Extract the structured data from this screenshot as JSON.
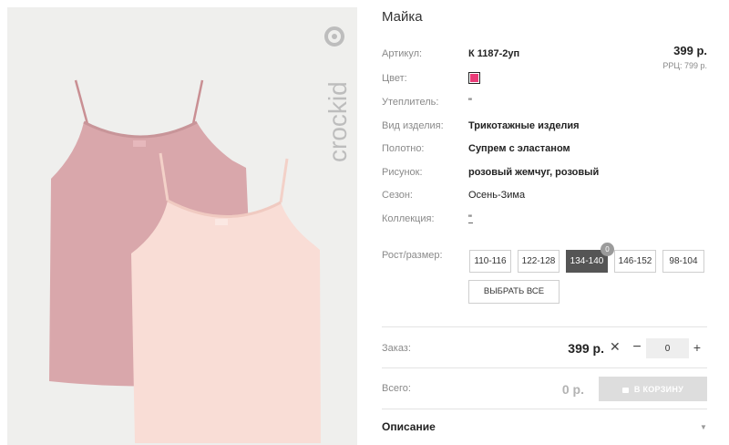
{
  "product": {
    "title": "Майка",
    "price": "399 р.",
    "rrp": "РРЦ: 799 р."
  },
  "brand": {
    "logo_text": "crockid"
  },
  "attributes": [
    {
      "label": "Артикул:",
      "value": "К 1187-2уп"
    },
    {
      "label": "Цвет:",
      "value": ""
    },
    {
      "label": "Утеплитель:",
      "value": "\""
    },
    {
      "label": "Вид изделия:",
      "value": "Трикотажные изделия"
    },
    {
      "label": "Полотно:",
      "value": "Супрем с эластаном"
    },
    {
      "label": "Рисунок:",
      "value": "розовый жемчуг, розовый"
    },
    {
      "label": "Сезон:",
      "value": "Осень-Зима"
    },
    {
      "label": "Коллекция:",
      "value": "\""
    }
  ],
  "color_swatch": "#ea3c78",
  "sizes": {
    "label": "Рост/размер:",
    "options": [
      "110-116",
      "122-128",
      "134-140",
      "146-152",
      "98-104"
    ],
    "selected": "134-140",
    "badge": "0",
    "select_all": "ВЫБРАТЬ ВСЕ"
  },
  "order": {
    "label": "Заказ:",
    "price": "399 р.",
    "times": "✕",
    "minus": "−",
    "qty": "0",
    "plus": "+"
  },
  "total": {
    "label": "Всего:",
    "price": "0 р.",
    "cart_button": "В КОРЗИНУ"
  },
  "description": {
    "label": "Описание",
    "chevron": "▼"
  }
}
